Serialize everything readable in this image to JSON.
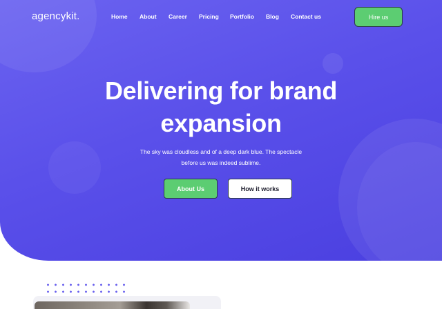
{
  "brand": {
    "logo_text": "agencykit."
  },
  "nav": {
    "items": [
      {
        "label": "Home"
      },
      {
        "label": "About"
      },
      {
        "label": "Career"
      },
      {
        "label": "Pricing"
      },
      {
        "label": "Portfolio"
      },
      {
        "label": "Blog"
      },
      {
        "label": "Contact us"
      }
    ],
    "cta_label": "Hire us"
  },
  "hero": {
    "title": "Delivering for brand expansion",
    "subtitle": "The sky was cloudless and of a deep dark blue. The spectacle before us was indeed sublime.",
    "primary_button": "About Us",
    "secondary_button": "How it works"
  },
  "colors": {
    "hero_background": "#5a50ea",
    "accent_green": "#5ccd72",
    "dot_pattern": "#6a62ee",
    "white": "#ffffff"
  }
}
